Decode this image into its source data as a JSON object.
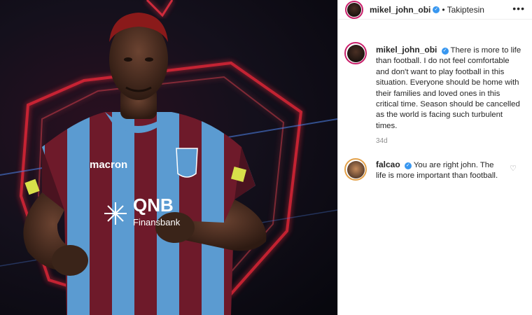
{
  "post": {
    "username": "mikel_john_obi",
    "verified_badge": "✓",
    "separator": "•",
    "follow_label": "Takiptesin",
    "more_icon": "•••",
    "caption": "There is more to life than football. I do not feel comfortable and don't want to play football in this situation. Everyone should be home with their families and loved ones in this critical time. Season should be cancelled as the world is facing such turbulent times.",
    "time": "34d"
  },
  "comments": [
    {
      "username": "falcao",
      "text": "You are right john. The life is more important than football.",
      "heart_icon": "♡"
    }
  ],
  "photo": {
    "sponsor_text": "macron",
    "bank_text": "QNB",
    "bank_sub": "Finansbank"
  },
  "colors": {
    "verified": "#3897f0",
    "avatar_ring": "#c9206b",
    "maroon": "#6e1a2a",
    "sky_blue": "#5b9bd1",
    "neon_red": "#ff2a3a"
  }
}
